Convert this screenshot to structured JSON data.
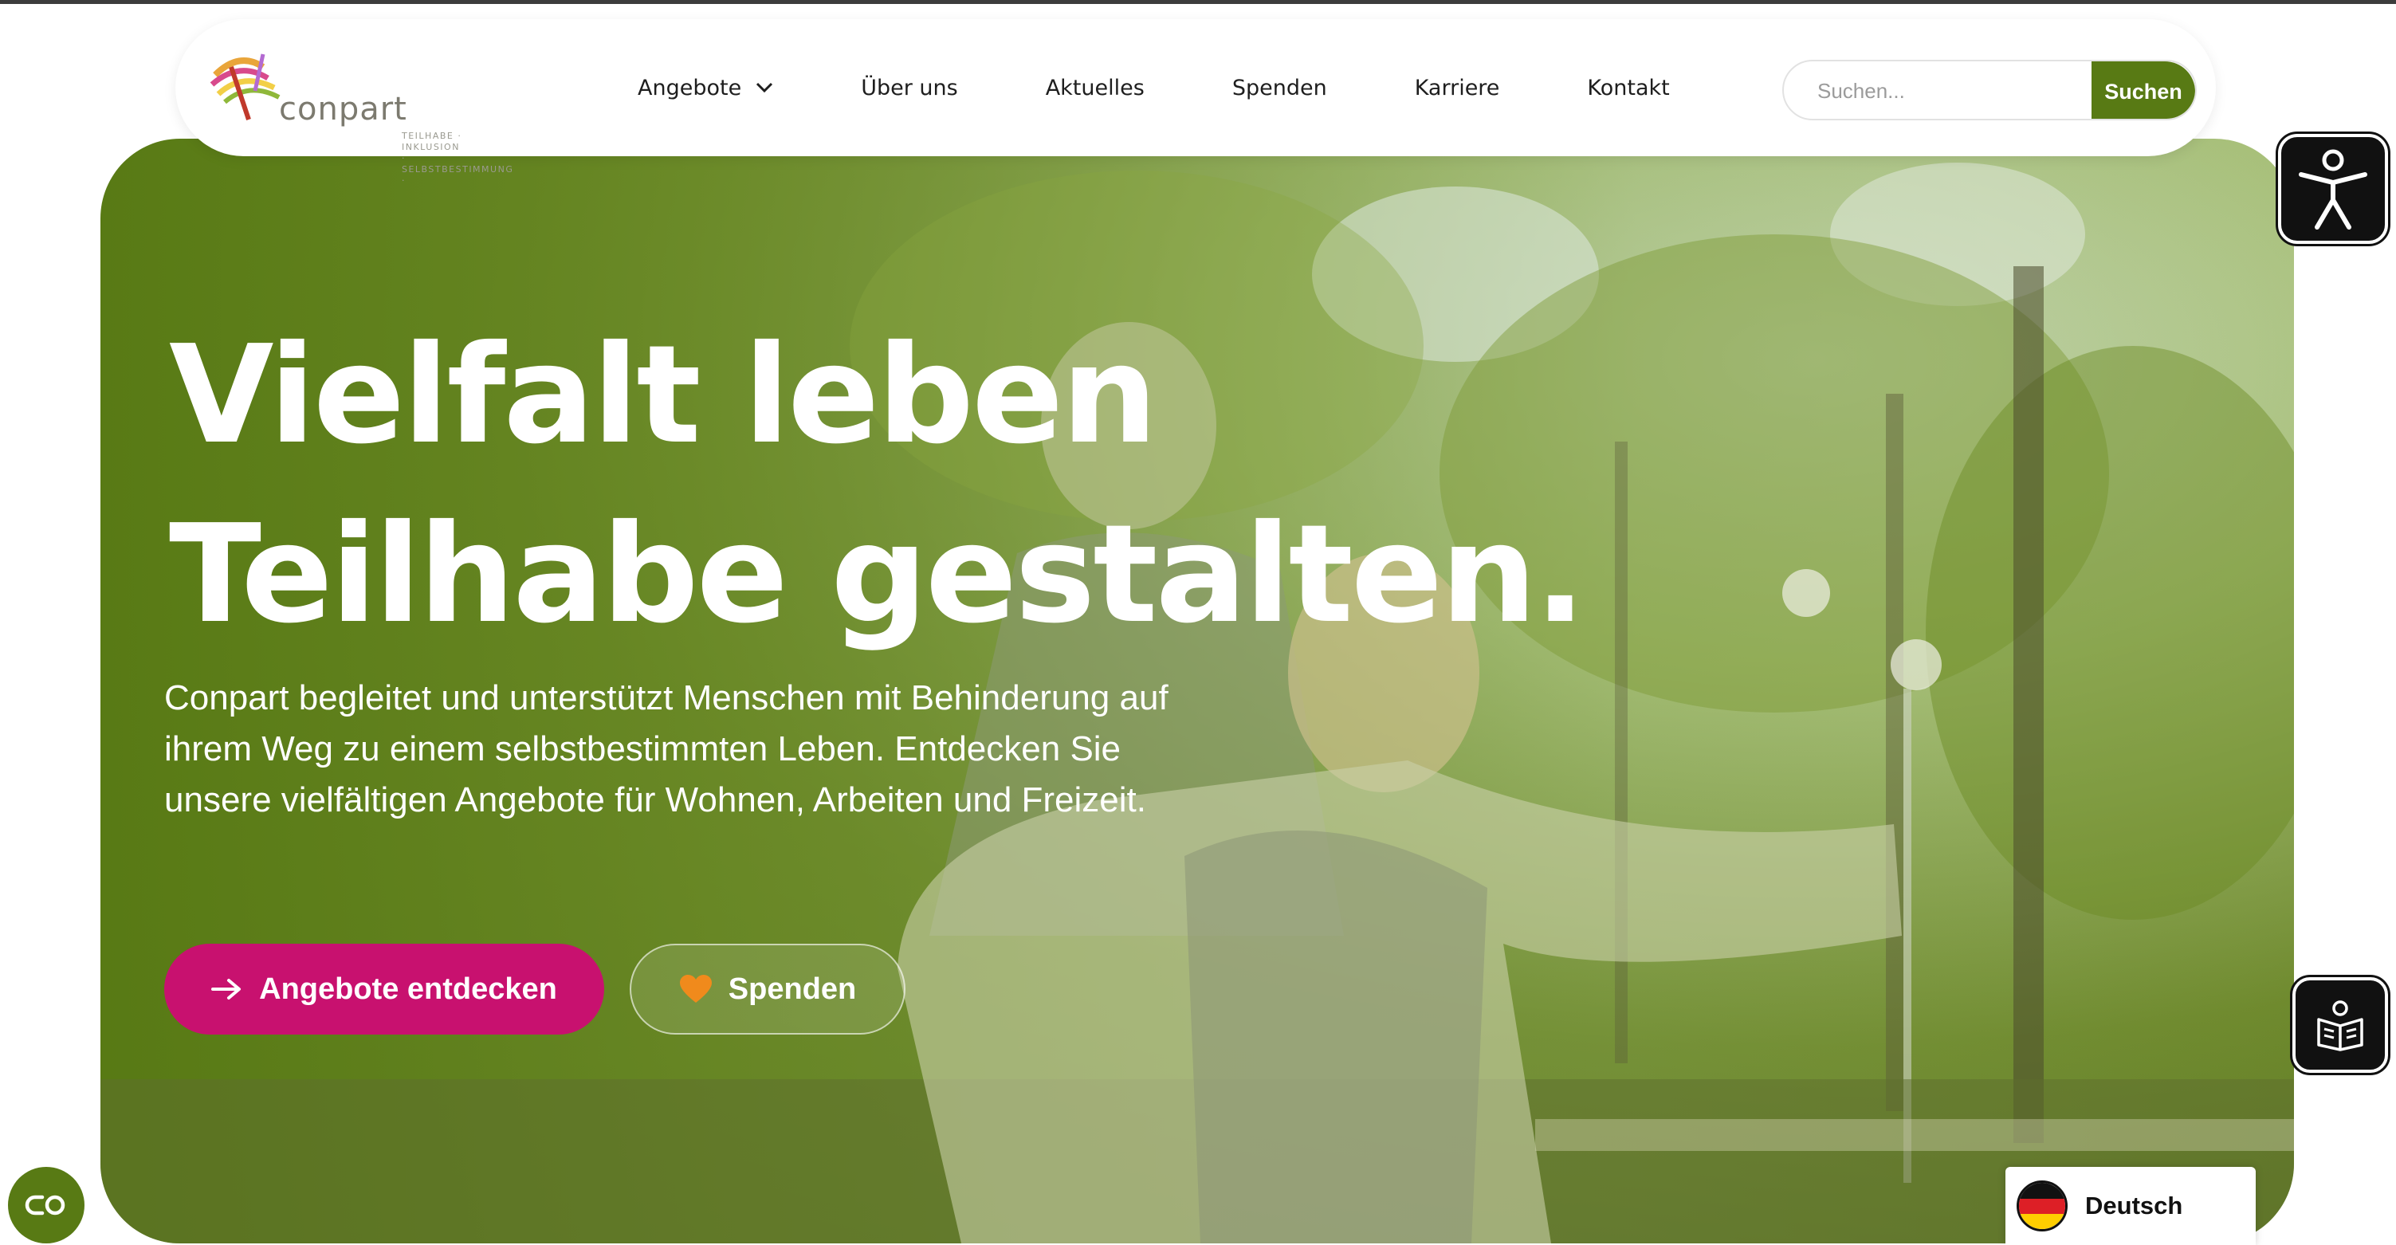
{
  "header": {
    "logo": {
      "wordmark": "conpart",
      "tagline_line1": "TEILHABE · INKLUSION",
      "tagline_line2": "· SELBSTBESTIMMUNG ·"
    },
    "nav": [
      {
        "label": "Angebote",
        "has_dropdown": true
      },
      {
        "label": "Über uns"
      },
      {
        "label": "Aktuelles"
      },
      {
        "label": "Spenden"
      },
      {
        "label": "Karriere"
      },
      {
        "label": "Kontakt"
      }
    ],
    "search": {
      "placeholder": "Suchen...",
      "value": "",
      "button_label": "Suchen"
    }
  },
  "hero": {
    "title_line1": "Vielfalt leben",
    "title_line2": "Teilhabe gestalten.",
    "text": "Conpart begleitet und unterstützt Menschen mit Behinderung auf ihrem Weg zu einem selbstbestimmten Leben. Entdecken Sie unsere vielfältigen Angebote für Wohnen, Arbeiten und Freizeit.",
    "primary_button": {
      "label": "Angebote entdecken",
      "icon": "arrow-right-icon"
    },
    "secondary_button": {
      "label": "Spenden",
      "icon": "heart-icon"
    }
  },
  "widgets": {
    "accessibility_icon": "accessibility-person-icon",
    "reader_icon": "book-reader-icon",
    "cookie_icon": "cookie-settings-icon",
    "language": {
      "label": "Deutsch",
      "flag": "german-flag-icon"
    }
  },
  "colors": {
    "brand_green": "#587a14",
    "primary_magenta": "#c8116f",
    "heart_orange": "#f08a1c",
    "widget_black": "#111111"
  }
}
